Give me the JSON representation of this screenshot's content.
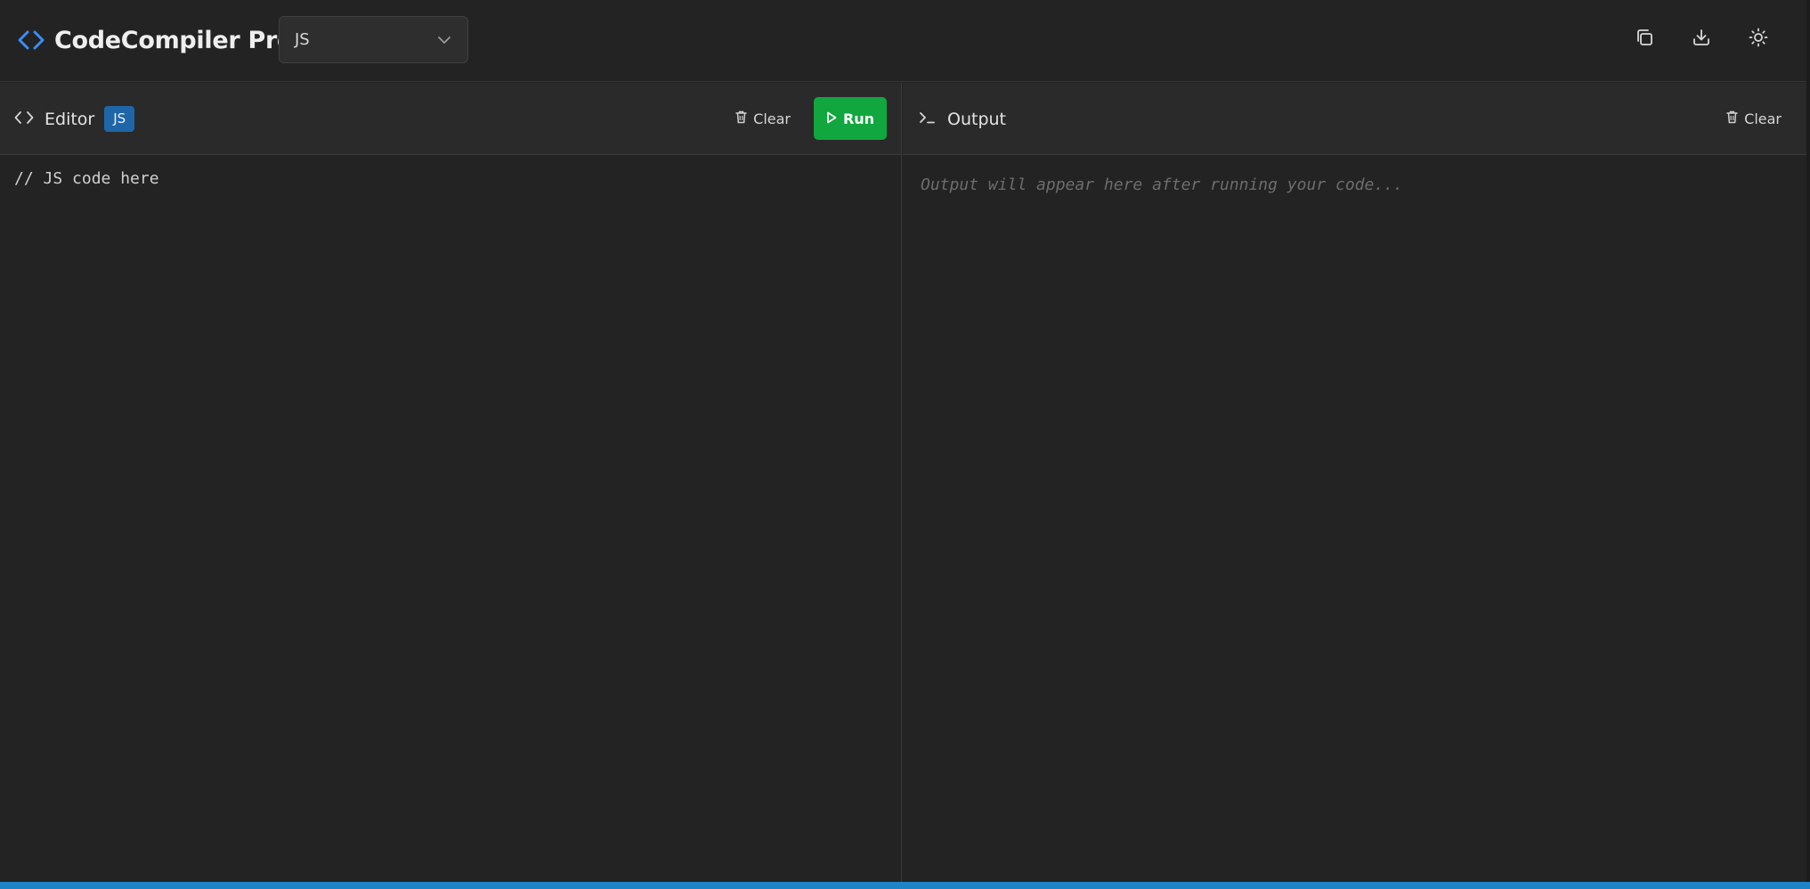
{
  "header": {
    "app_title": "CodeCompiler Pro",
    "language_selected": "JS",
    "logo_icon": "code-brackets-icon",
    "actions": [
      {
        "name": "copy-button",
        "icon": "copy-icon"
      },
      {
        "name": "download-button",
        "icon": "download-icon"
      },
      {
        "name": "theme-toggle-button",
        "icon": "sun-icon"
      }
    ]
  },
  "editor": {
    "title": "Editor",
    "language_badge": "JS",
    "clear_label": "Clear",
    "run_label": "Run",
    "code": "// JS code here"
  },
  "output": {
    "title": "Output",
    "clear_label": "Clear",
    "placeholder": "Output will appear here after running your code..."
  },
  "colors": {
    "background": "#232323",
    "panel_header": "#2a2a2a",
    "accent_blue": "#3b8df5",
    "badge_blue": "#1f66a8",
    "run_green": "#12a63f",
    "status_strip": "#1d84c9"
  }
}
